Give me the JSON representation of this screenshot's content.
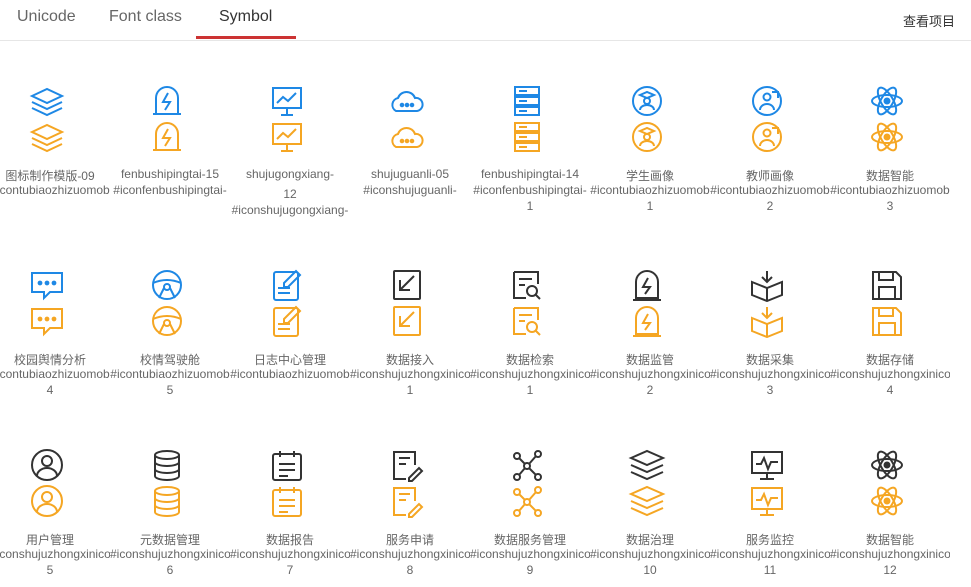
{
  "tabs": [
    {
      "label": "Unicode"
    },
    {
      "label": "Font class"
    },
    {
      "label": "Symbol"
    }
  ],
  "header": {
    "view_project": "查看项目"
  },
  "colors": {
    "blue": "#1e88e5",
    "orange": "#f5a623",
    "dark": "#333333",
    "tab_underline": "#cc3333"
  },
  "rows": [
    [
      {
        "name": "图标制作模版-09",
        "code": "#icontubiaozhizuomob",
        "code2": ""
      },
      {
        "name": "fenbushipingtai-15",
        "code": "#iconfenbushipingtai-",
        "code2": ""
      },
      {
        "name": "shujugongxiang-",
        "code": "12",
        "code2": "#iconshujugongxiang-"
      },
      {
        "name": "shujuguanli-05",
        "code": "#iconshujuguanli-",
        "code2": ""
      },
      {
        "name": "fenbushipingtai-14",
        "code": "#iconfenbushipingtai-",
        "code2": "1"
      },
      {
        "name": "学生画像",
        "code": "#icontubiaozhizuomob",
        "code2": "1"
      },
      {
        "name": "教师画像",
        "code": "#icontubiaozhizuomob",
        "code2": "2"
      },
      {
        "name": "数据智能",
        "code": "#icontubiaozhizuomob",
        "code2": "3"
      }
    ],
    [
      {
        "name": "校园舆情分析",
        "code": "#icontubiaozhizuomob",
        "code2": "4"
      },
      {
        "name": "校情驾驶舱",
        "code": "#icontubiaozhizuomob",
        "code2": "5"
      },
      {
        "name": "日志中心管理",
        "code": "#icontubiaozhizuomob",
        "code2": ""
      },
      {
        "name": "数据接入",
        "code": "#iconshujuzhongxinicon",
        "code2": "1"
      },
      {
        "name": "数据检索",
        "code": "#iconshujuzhongxinicon",
        "code2": "1"
      },
      {
        "name": "数据监管",
        "code": "#iconshujuzhongxinicon",
        "code2": "2"
      },
      {
        "name": "数据采集",
        "code": "#iconshujuzhongxinicon",
        "code2": "3"
      },
      {
        "name": "数据存储",
        "code": "#iconshujuzhongxinicon",
        "code2": "4"
      }
    ],
    [
      {
        "name": "用户管理",
        "code": "#iconshujuzhongxinicon",
        "code2": "5"
      },
      {
        "name": "元数据管理",
        "code": "#iconshujuzhongxinicon",
        "code2": "6"
      },
      {
        "name": "数据报告",
        "code": "#iconshujuzhongxinicon",
        "code2": "7"
      },
      {
        "name": "服务申请",
        "code": "#iconshujuzhongxinicon",
        "code2": "8"
      },
      {
        "name": "数据服务管理",
        "code": "#iconshujuzhongxinicon",
        "code2": "9"
      },
      {
        "name": "数据治理",
        "code": "#iconshujuzhongxinicon",
        "code2": "10"
      },
      {
        "name": "服务监控",
        "code": "#iconshujuzhongxinicon",
        "code2": "11"
      },
      {
        "name": "数据智能",
        "code": "#iconshujuzhongxinicon",
        "code2": "12"
      }
    ]
  ]
}
